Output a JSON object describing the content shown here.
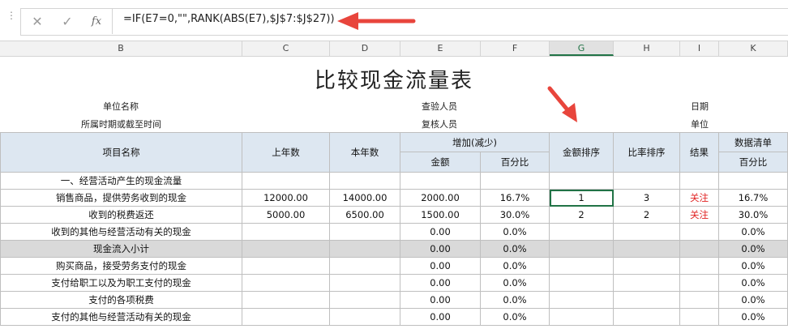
{
  "formula_bar": {
    "formula": "=IF(E7=0,\"\",RANK(ABS(E7),$J$7:$J$27))",
    "cancel_icon": "close-icon",
    "enter_icon": "check-icon",
    "function_label": "fx"
  },
  "columns": [
    "B",
    "C",
    "D",
    "E",
    "F",
    "G",
    "H",
    "I",
    "K"
  ],
  "selected_column": "G",
  "sheet": {
    "title": "比较现金流量表",
    "info": {
      "unit_name": "单位名称",
      "period": "所属时期或截至时间",
      "checker": "查验人员",
      "reviewer": "复核人员",
      "date": "日期",
      "unit": "单位"
    },
    "headers": {
      "item": "项目名称",
      "prev_year": "上年数",
      "this_year": "本年数",
      "change": "增加(减少)",
      "amount": "金额",
      "percent": "百分比",
      "amount_rank": "金额排序",
      "ratio_rank": "比率排序",
      "result": "结果",
      "data_list": "数据清单",
      "data_percent": "百分比"
    },
    "rows": [
      {
        "item": "一、经营活动产生的现金流量",
        "prev": "",
        "cur": "",
        "amount": "",
        "pct": "",
        "rank_amt": "",
        "rank_ratio": "",
        "result": "",
        "list_pct": ""
      },
      {
        "item": "销售商品，提供劳务收到的现金",
        "prev": "12000.00",
        "cur": "14000.00",
        "amount": "2000.00",
        "pct": "16.7%",
        "rank_amt": "1",
        "rank_ratio": "3",
        "result": "关注",
        "list_pct": "16.7%"
      },
      {
        "item": "收到的税费返还",
        "prev": "5000.00",
        "cur": "6500.00",
        "amount": "1500.00",
        "pct": "30.0%",
        "rank_amt": "2",
        "rank_ratio": "2",
        "result": "关注",
        "list_pct": "30.0%"
      },
      {
        "item": "收到的其他与经营活动有关的现金",
        "prev": "",
        "cur": "",
        "amount": "0.00",
        "pct": "0.0%",
        "rank_amt": "",
        "rank_ratio": "",
        "result": "",
        "list_pct": "0.0%"
      },
      {
        "item": "现金流入小计",
        "prev": "",
        "cur": "",
        "amount": "0.00",
        "pct": "0.0%",
        "rank_amt": "",
        "rank_ratio": "",
        "result": "",
        "list_pct": "0.0%",
        "gray": true
      },
      {
        "item": "购买商品，接受劳务支付的现金",
        "prev": "",
        "cur": "",
        "amount": "0.00",
        "pct": "0.0%",
        "rank_amt": "",
        "rank_ratio": "",
        "result": "",
        "list_pct": "0.0%"
      },
      {
        "item": "支付给职工以及为职工支付的现金",
        "prev": "",
        "cur": "",
        "amount": "0.00",
        "pct": "0.0%",
        "rank_amt": "",
        "rank_ratio": "",
        "result": "",
        "list_pct": "0.0%"
      },
      {
        "item": "支付的各项税费",
        "prev": "",
        "cur": "",
        "amount": "0.00",
        "pct": "0.0%",
        "rank_amt": "",
        "rank_ratio": "",
        "result": "",
        "list_pct": "0.0%"
      },
      {
        "item": "支付的其他与经营活动有关的现金",
        "prev": "",
        "cur": "",
        "amount": "0.00",
        "pct": "0.0%",
        "rank_amt": "",
        "rank_ratio": "",
        "result": "",
        "list_pct": "0.0%"
      }
    ]
  },
  "colors": {
    "header_fill": "#dde7f1",
    "gray_fill": "#d9d9d9",
    "alert_red": "#e02020",
    "arrow_red": "#e8453c",
    "excel_green": "#217346"
  }
}
